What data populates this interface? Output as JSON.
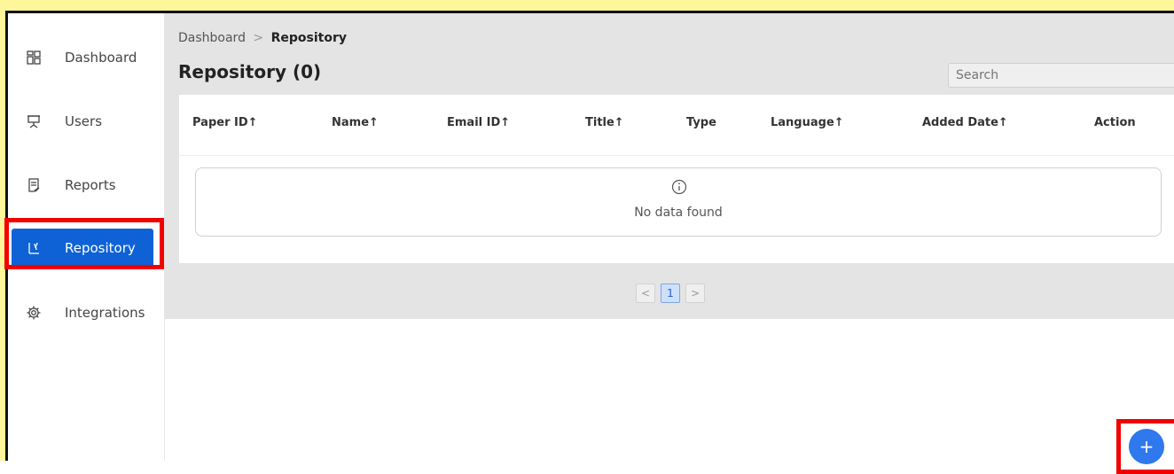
{
  "sidebar": {
    "items": [
      {
        "label": "Dashboard",
        "icon": "dashboard-icon",
        "active": false
      },
      {
        "label": "Users",
        "icon": "presentation-icon",
        "active": false
      },
      {
        "label": "Reports",
        "icon": "report-icon",
        "active": false
      },
      {
        "label": "Repository",
        "icon": "branch-icon",
        "active": true
      },
      {
        "label": "Integrations",
        "icon": "gear-icon",
        "active": false
      }
    ]
  },
  "breadcrumb": {
    "root": "Dashboard",
    "separator": ">",
    "current": "Repository"
  },
  "page": {
    "title": "Repository (0)"
  },
  "search": {
    "placeholder": "Search"
  },
  "table": {
    "columns": [
      "Paper ID↑",
      "Name↑",
      "Email ID↑",
      "Title↑",
      "Type",
      "Language↑",
      "Added Date↑",
      "Action"
    ],
    "empty_message": "No data found"
  },
  "pagination": {
    "prev": "<",
    "current": "1",
    "next": ">"
  },
  "fab": {
    "label": "+"
  },
  "colors": {
    "accent": "#0e62d6",
    "highlight": "#f10000",
    "frame": "#fff59a"
  }
}
